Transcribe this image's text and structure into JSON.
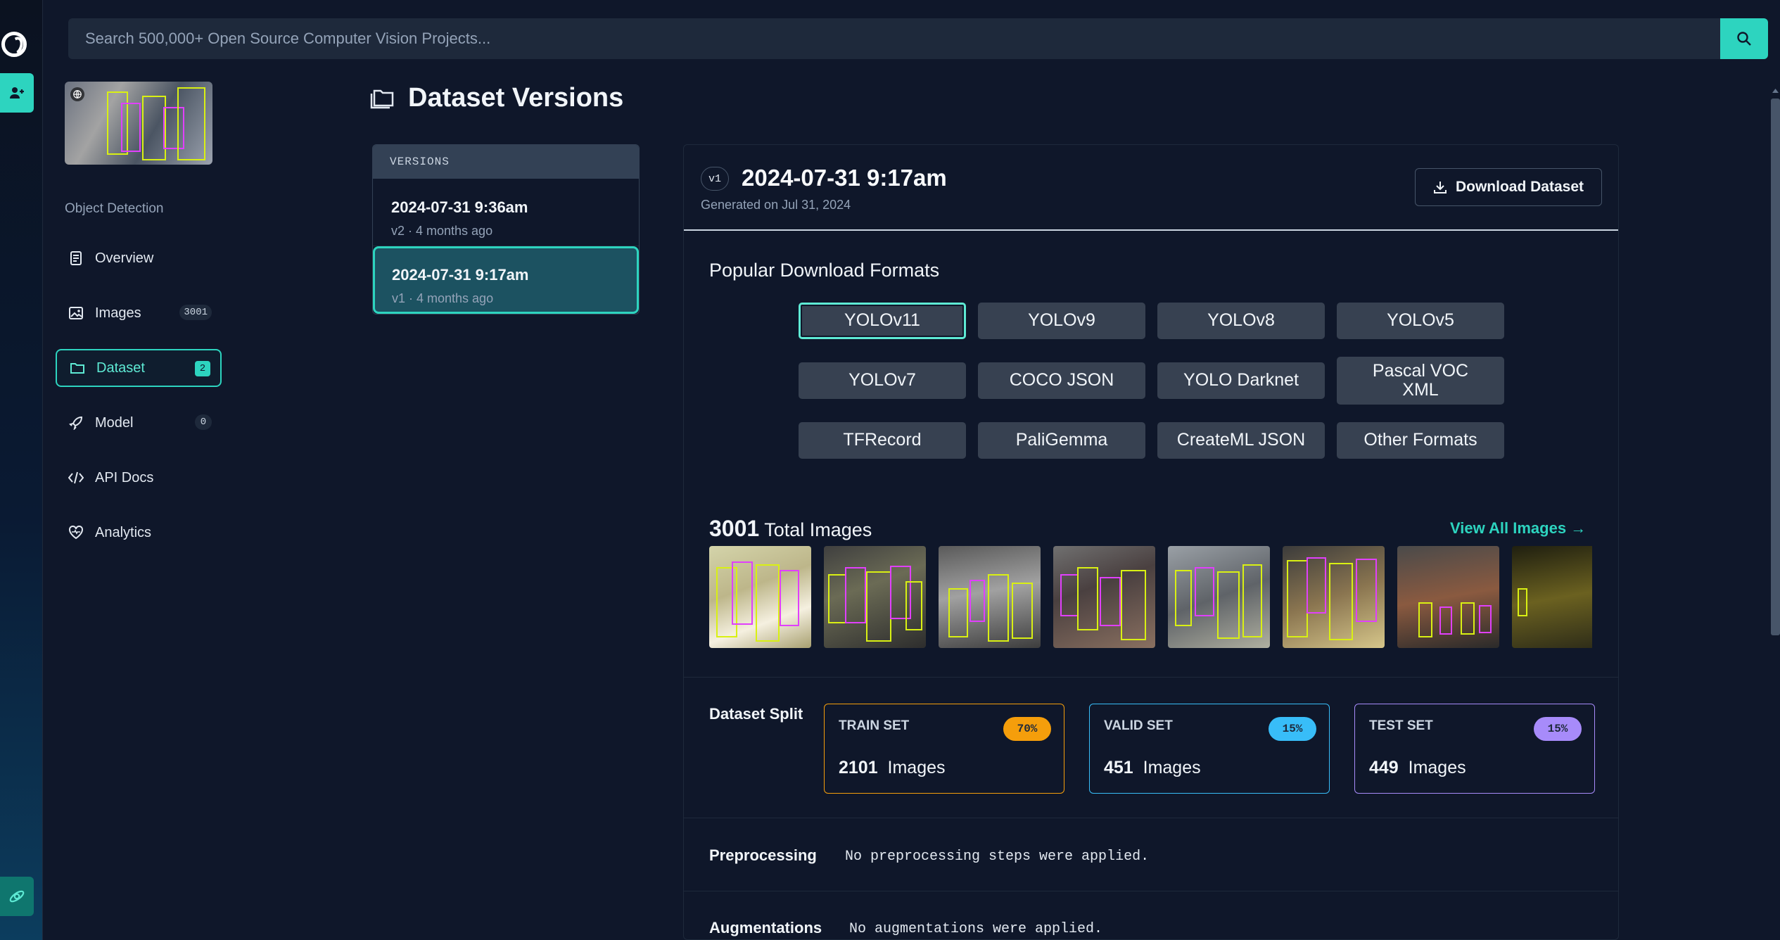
{
  "search": {
    "placeholder": "Search 500,000+ Open Source Computer Vision Projects..."
  },
  "sidebar": {
    "project_type": "Object Detection",
    "items": [
      {
        "label": "Overview",
        "badge": "",
        "icon": "overview-icon"
      },
      {
        "label": "Images",
        "badge": "3001",
        "icon": "images-icon"
      },
      {
        "label": "Dataset",
        "badge": "2",
        "icon": "folder-icon",
        "active": true
      },
      {
        "label": "Model",
        "badge": "0",
        "icon": "rocket-icon"
      },
      {
        "label": "API Docs",
        "badge": "",
        "icon": "code-icon"
      },
      {
        "label": "Analytics",
        "badge": "",
        "icon": "heart-pulse-icon"
      }
    ]
  },
  "page": {
    "title": "Dataset Versions"
  },
  "versions": {
    "header": "VERSIONS",
    "items": [
      {
        "name": "2024-07-31 9:36am",
        "meta": "v2 · 4 months ago"
      },
      {
        "name": "2024-07-31 9:17am",
        "meta": "v1 · 4 months ago",
        "active": true
      }
    ]
  },
  "version_detail": {
    "badge": "v1",
    "title": "2024-07-31 9:17am",
    "generated": "Generated on Jul 31, 2024",
    "download_label": "Download Dataset",
    "formats_title": "Popular Download Formats",
    "formats": [
      "YOLOv11",
      "YOLOv9",
      "YOLOv8",
      "YOLOv5",
      "YOLOv7",
      "COCO JSON",
      "YOLO Darknet",
      "Pascal VOC XML",
      "TFRecord",
      "PaliGemma",
      "CreateML JSON",
      "Other Formats"
    ],
    "selected_format": "YOLOv11",
    "total_count": "3001",
    "total_label": "Total Images",
    "view_all": "View All Images",
    "split_label": "Dataset Split",
    "splits": [
      {
        "name": "TRAIN SET",
        "pct": "70%",
        "count": "2101",
        "unit": "Images",
        "color": "#f59e0b"
      },
      {
        "name": "VALID SET",
        "pct": "15%",
        "count": "451",
        "unit": "Images",
        "color": "#38bdf8"
      },
      {
        "name": "TEST SET",
        "pct": "15%",
        "count": "449",
        "unit": "Images",
        "color": "#a78bfa"
      }
    ],
    "preprocessing_label": "Preprocessing",
    "preprocessing_value": "No preprocessing steps were applied.",
    "augmentations_label": "Augmentations",
    "augmentations_value": "No augmentations were applied."
  },
  "colors": {
    "accent": "#2dd4bf",
    "background": "#0f172a",
    "panel": "#1e293b"
  }
}
